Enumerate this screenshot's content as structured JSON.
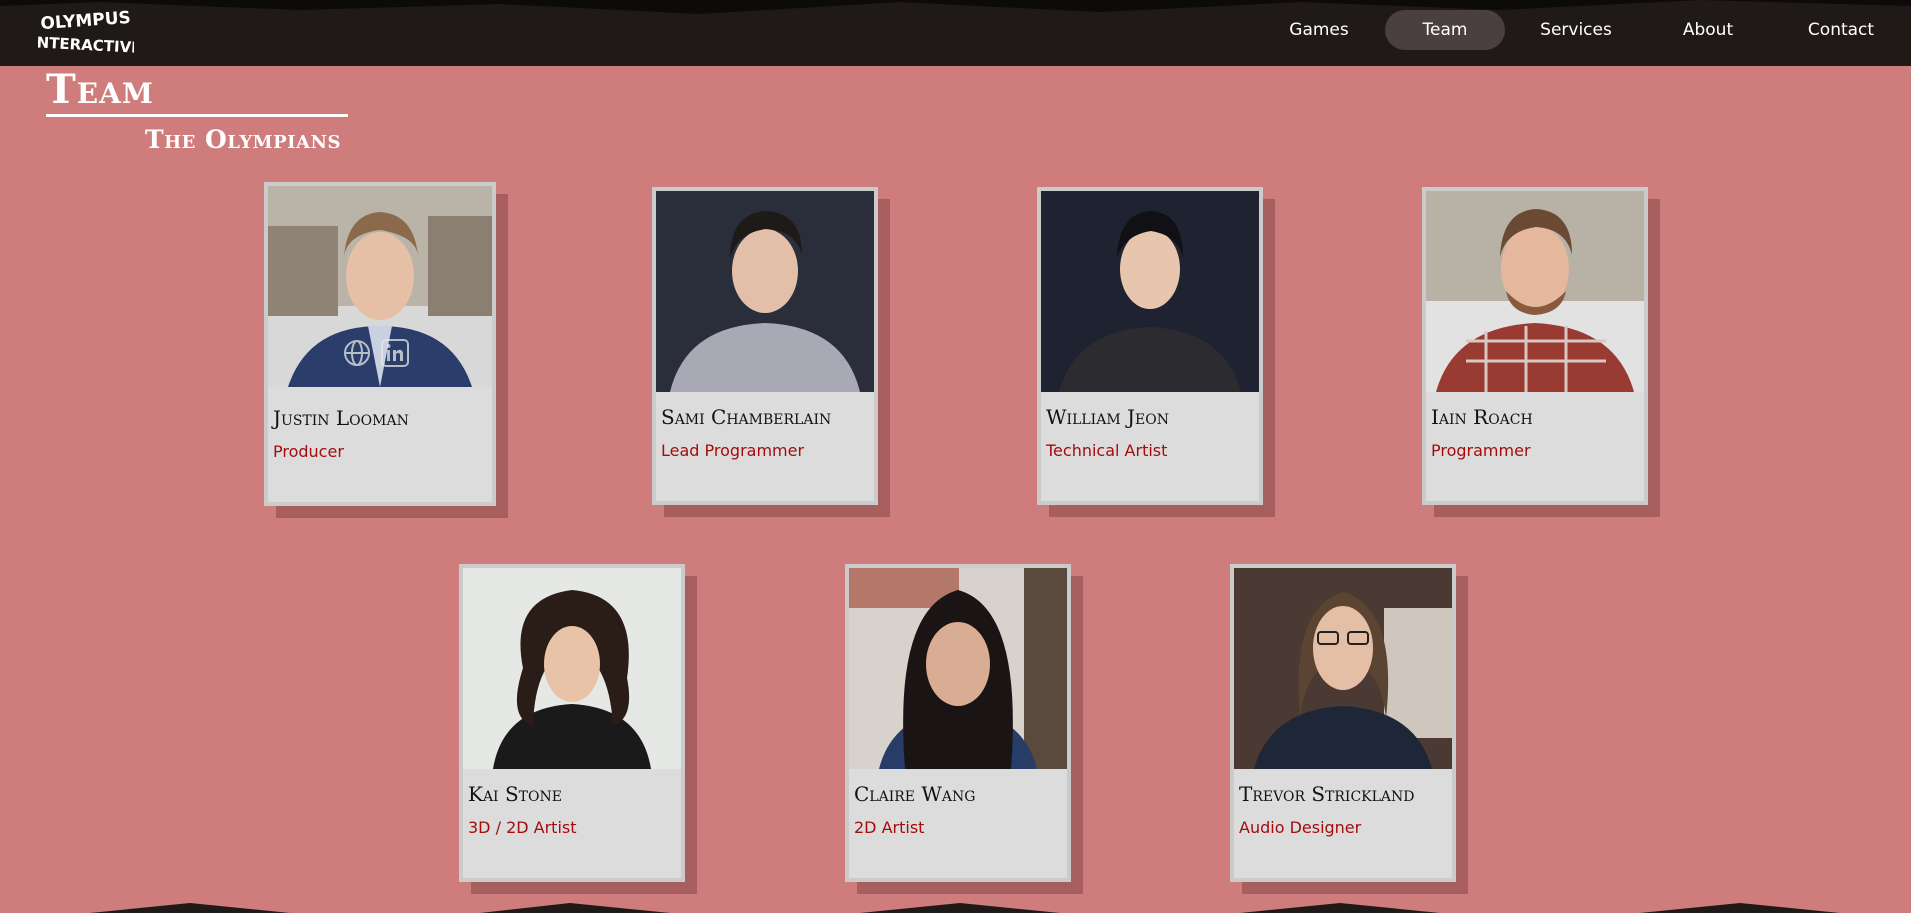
{
  "brand": {
    "logo_alt": "Olympus Interactive",
    "logo_text_top": "OLYMPUS",
    "logo_text_bottom": "INTERACTIVE"
  },
  "nav": {
    "items": [
      {
        "label": "Games",
        "active": false
      },
      {
        "label": "Team",
        "active": true
      },
      {
        "label": "Services",
        "active": false
      },
      {
        "label": "About",
        "active": false
      },
      {
        "label": "Contact",
        "active": false
      }
    ]
  },
  "page": {
    "title": "Team",
    "subtitle": "The Olympians"
  },
  "colors": {
    "background": "#cf7c7c",
    "header": "#1f1918",
    "role_text": "#a40c0c",
    "card": "#dcdcdc"
  },
  "members": [
    {
      "name": "Justin Looman",
      "role": "Producer",
      "photo": "portrait-outdoor-suit",
      "social_icons": [
        "globe-icon",
        "linkedin-icon"
      ]
    },
    {
      "name": "Sami Chamberlain",
      "role": "Lead Programmer",
      "photo": "portrait-dark-studio"
    },
    {
      "name": "William Jeon",
      "role": "Technical Artist",
      "photo": "portrait-dark-studio"
    },
    {
      "name": "Iain Roach",
      "role": "Programmer",
      "photo": "portrait-outdoor-plaid"
    },
    {
      "name": "Kai Stone",
      "role": "3D / 2D Artist",
      "photo": "portrait-light-wall"
    },
    {
      "name": "Claire Wang",
      "role": "2D Artist",
      "photo": "portrait-indoor"
    },
    {
      "name": "Trevor Strickland",
      "role": "Audio Designer",
      "photo": "portrait-indoor-dark"
    }
  ]
}
